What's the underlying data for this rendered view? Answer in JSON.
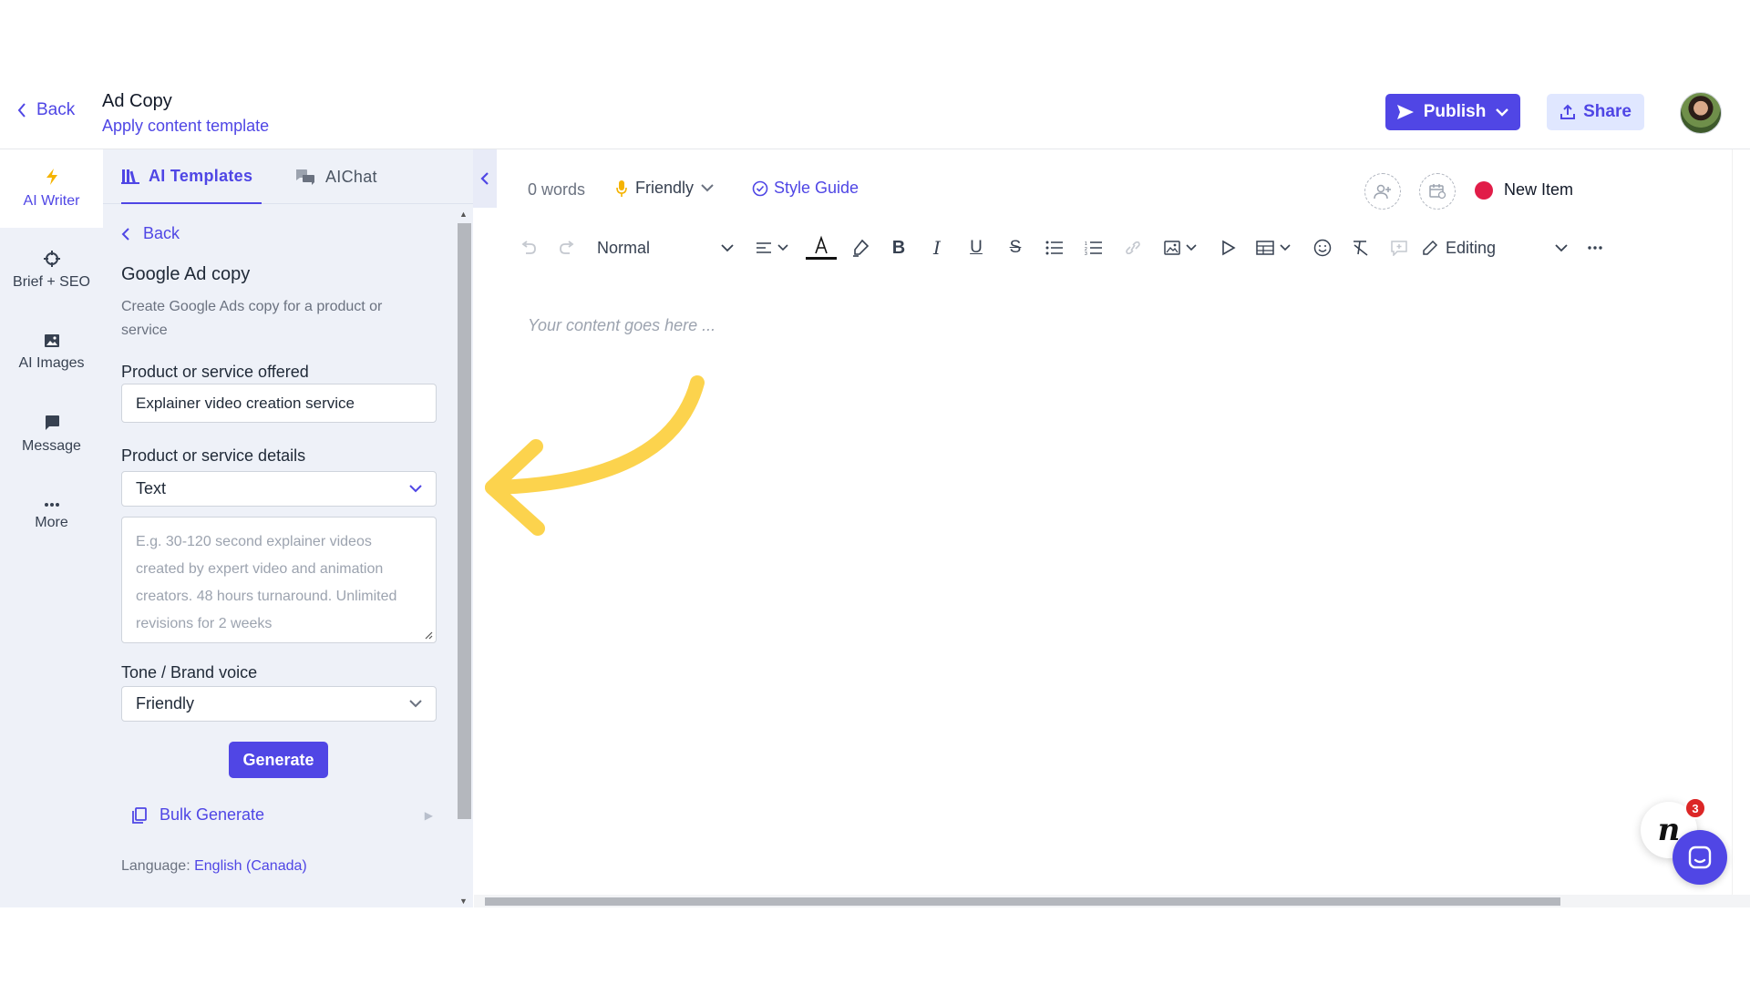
{
  "header": {
    "back_label": "Back",
    "title": "Ad Copy",
    "subtitle": "Apply content template",
    "publish_label": "Publish",
    "share_label": "Share"
  },
  "rail": {
    "items": [
      {
        "label": "AI Writer",
        "icon": "bolt-icon"
      },
      {
        "label": "Brief + SEO",
        "icon": "crosshair-icon"
      },
      {
        "label": "AI Images",
        "icon": "image-icon"
      },
      {
        "label": "Message",
        "icon": "message-icon"
      },
      {
        "label": "More",
        "icon": "more-icon"
      }
    ]
  },
  "panel": {
    "tabs": [
      {
        "label": "AI Templates",
        "icon": "library-icon"
      },
      {
        "label": "AIChat",
        "icon": "chat-bubbles-icon"
      }
    ],
    "back_label": "Back",
    "template_title": "Google Ad copy",
    "template_description": "Create Google Ads copy for a product or service",
    "product_label": "Product or service offered",
    "product_value": "Explainer video creation service",
    "details_label": "Product or service details",
    "details_type": "Text",
    "details_placeholder": "E.g. 30-120 second explainer videos created by expert video and animation creators. 48 hours turnaround. Unlimited revisions for 2 weeks",
    "tone_label": "Tone / Brand voice",
    "tone_value": "Friendly",
    "generate_label": "Generate",
    "bulk_label": "Bulk Generate",
    "language_prefix": "Language:",
    "language_value": "English (Canada)"
  },
  "editor": {
    "word_count": "0 words",
    "tone": "Friendly",
    "style_guide": "Style Guide",
    "status": "New Item",
    "block_style": "Normal",
    "mode": "Editing",
    "placeholder": "Your content goes here ..."
  },
  "widgets": {
    "notification_count": "3",
    "assistant_logo": "n"
  },
  "colors": {
    "accent": "#5046e5",
    "status_dot": "#e11d48",
    "annotation_arrow": "#fcd34d"
  }
}
